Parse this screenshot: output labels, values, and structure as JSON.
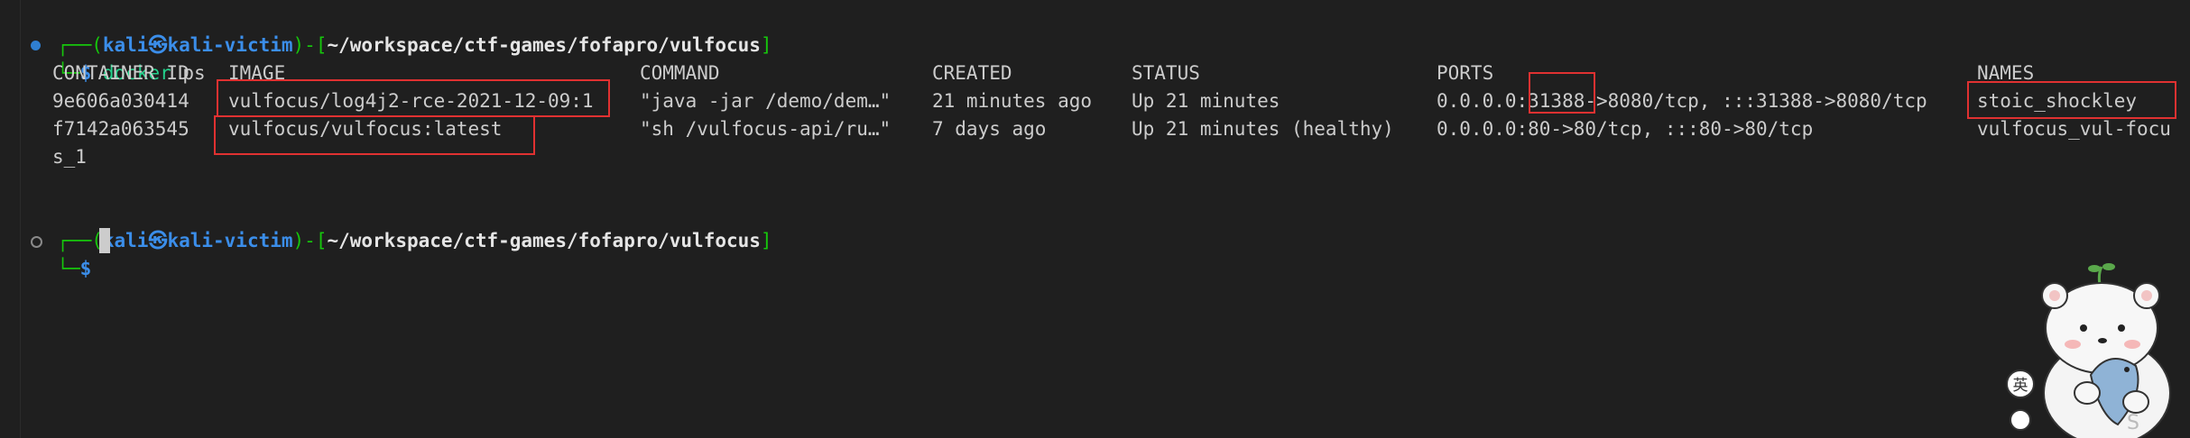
{
  "prompt": {
    "user_host": "kali㉿kali-victim",
    "path": "~/workspace/ctf-games/fofapro/vulfocus",
    "dollar": "$"
  },
  "command1": {
    "cmd": "docker",
    "args": " ps"
  },
  "table": {
    "headers": [
      "CONTAINER ID",
      "IMAGE",
      "COMMAND",
      "CREATED",
      "STATUS",
      "PORTS",
      "NAMES"
    ],
    "rows": [
      [
        "9e606a030414",
        "vulfocus/log4j2-rce-2021-12-09:1",
        "\"java -jar /demo/dem…\"",
        "21 minutes ago",
        "Up 21 minutes",
        "0.0.0.0:31388->8080/tcp, :::31388->8080/tcp",
        "stoic_shockley"
      ],
      [
        "f7142a063545",
        "vulfocus/vulfocus:latest",
        "\"sh /vulfocus-api/ru…\"",
        "7 days ago",
        "Up 21 minutes (healthy)",
        "0.0.0.0:80->80/tcp, :::80->80/tcp",
        "vulfocus_vul-focu"
      ]
    ],
    "wrap": "s_1"
  },
  "mascot": {
    "icon": "bear-mascot-icon",
    "badge_text": "英",
    "letter": "S"
  },
  "colors": {
    "background": "#1f1f1f",
    "text": "#cccccc",
    "prompt_green": "#16c60c",
    "prompt_blue": "#3b8eea",
    "highlight_red": "#e03131"
  }
}
